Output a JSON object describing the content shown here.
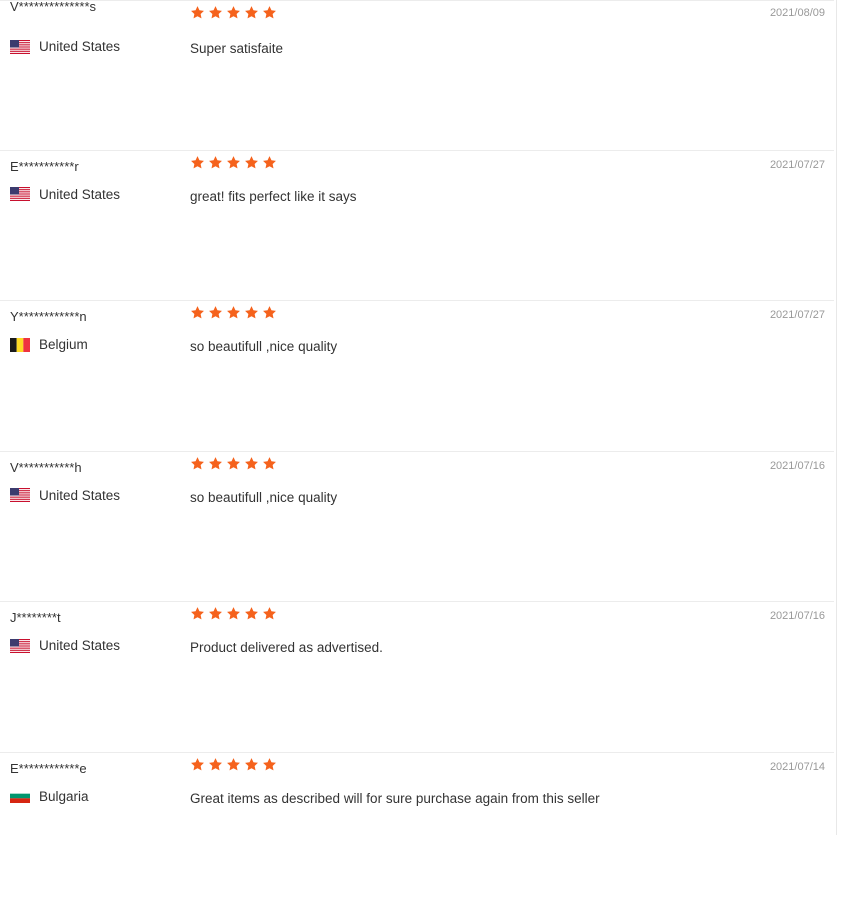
{
  "colors": {
    "star": "#f5621c",
    "text": "#333333",
    "date": "#999999",
    "divider": "#ececec"
  },
  "reviews": [
    {
      "user": "V**************s",
      "country": "United States",
      "flag_icon": "us-flag-icon",
      "rating": 5,
      "feedback": "Super satisfaite",
      "date": "2021/08/09"
    },
    {
      "user": "E***********r",
      "country": "United States",
      "flag_icon": "us-flag-icon",
      "rating": 5,
      "feedback": "great! fits perfect like it says",
      "date": "2021/07/27"
    },
    {
      "user": "Y************n",
      "country": "Belgium",
      "flag_icon": "be-flag-icon",
      "rating": 5,
      "feedback": "so beautifull ,nice quality",
      "date": "2021/07/27"
    },
    {
      "user": "V***********h",
      "country": "United States",
      "flag_icon": "us-flag-icon",
      "rating": 5,
      "feedback": "so beautifull ,nice quality",
      "date": "2021/07/16"
    },
    {
      "user": "J********t",
      "country": "United States",
      "flag_icon": "us-flag-icon",
      "rating": 5,
      "feedback": "Product delivered as advertised.",
      "date": "2021/07/16"
    },
    {
      "user": "E************e",
      "country": "Bulgaria",
      "flag_icon": "bg-flag-icon",
      "rating": 5,
      "feedback": "Great items as described will for sure purchase again from this seller",
      "date": "2021/07/14"
    }
  ]
}
